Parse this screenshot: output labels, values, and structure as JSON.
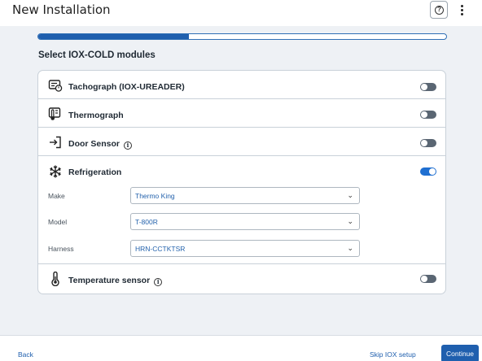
{
  "header": {
    "title": "New Installation",
    "help_icon": "help-circle-icon",
    "menu_icon": "more-vertical-icon"
  },
  "progress": {
    "fraction": 0.37
  },
  "section_title": "Select IOX-COLD modules",
  "modules": [
    {
      "label": "Tachograph (IOX-UREADER)",
      "icon": "tachograph-icon",
      "info": false,
      "enabled": false
    },
    {
      "label": "Thermograph",
      "icon": "thermograph-icon",
      "info": false,
      "enabled": false
    },
    {
      "label": "Door Sensor",
      "icon": "door-enter-icon",
      "info": true,
      "enabled": false
    },
    {
      "label": "Refrigeration",
      "icon": "snowflake-icon",
      "info": false,
      "enabled": true
    },
    {
      "label": "Temperature sensor",
      "icon": "thermometer-icon",
      "info": true,
      "enabled": false
    }
  ],
  "refrigeration_fields": {
    "make_label": "Make",
    "make_value": "Thermo King",
    "model_label": "Model",
    "model_value": "T-800R",
    "harness_label": "Harness",
    "harness_value": "HRN-CCTKTSR"
  },
  "footer": {
    "back_label": "Back",
    "skip_label": "Skip IOX setup",
    "continue_label": "Continue"
  },
  "colors": {
    "accent": "#1f5fae",
    "toggle_on": "#1f6fd1",
    "toggle_off": "#5a6673",
    "background": "#eef1f5"
  }
}
